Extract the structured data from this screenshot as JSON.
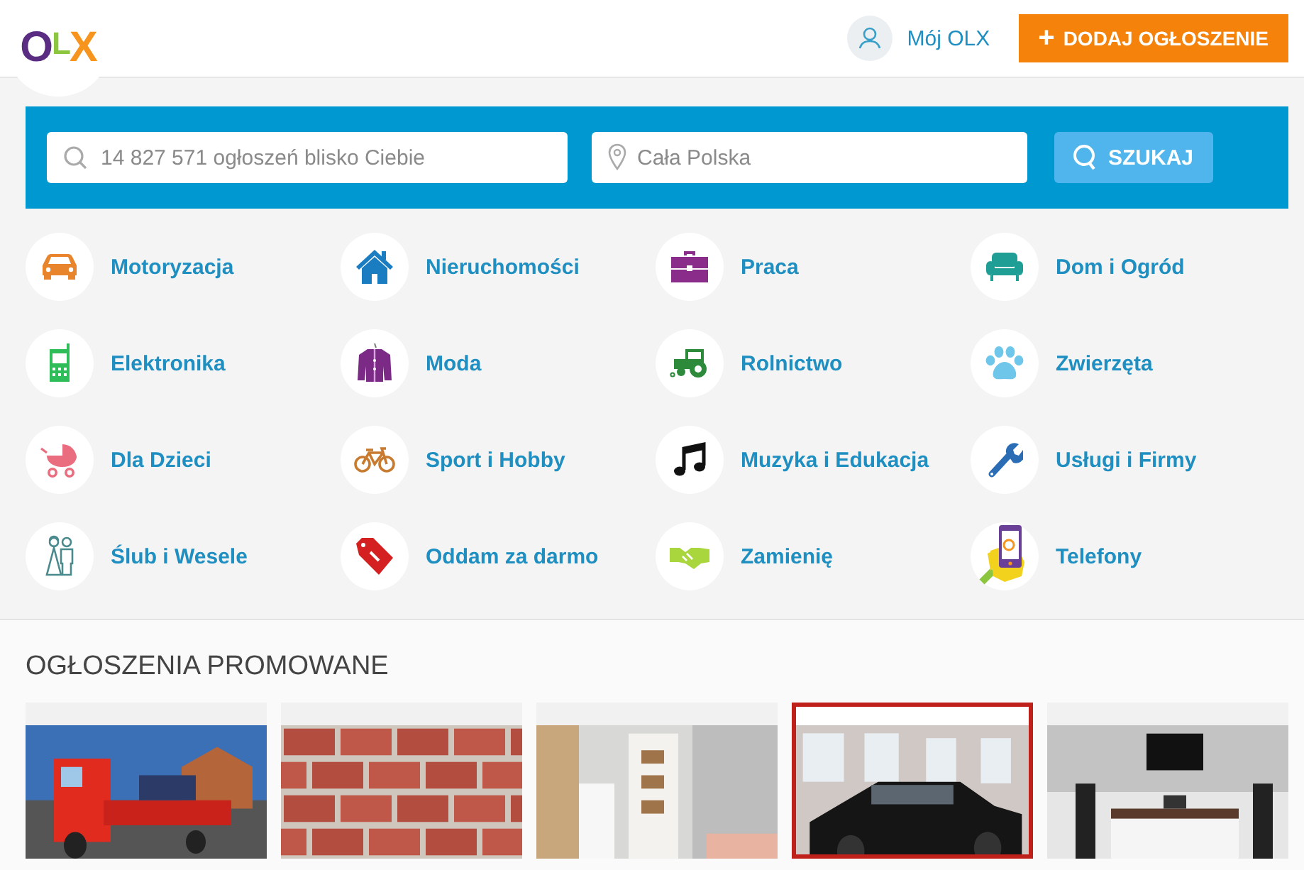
{
  "header": {
    "logo": "OLX",
    "account_link": "Mój OLX",
    "add_button": {
      "icon": "+",
      "label": "DODAJ OGŁOSZENIE"
    }
  },
  "search": {
    "query_placeholder": "14 827 571 ogłoszeń blisko Ciebie",
    "location_placeholder": "Cała Polska",
    "button": "SZUKAJ"
  },
  "categories": [
    {
      "label": "Motoryzacja",
      "kind": "car"
    },
    {
      "label": "Nieruchomości",
      "kind": "house"
    },
    {
      "label": "Praca",
      "kind": "briefcase"
    },
    {
      "label": "Dom i Ogród",
      "kind": "sofa"
    },
    {
      "label": "Elektronika",
      "kind": "phone"
    },
    {
      "label": "Moda",
      "kind": "coat"
    },
    {
      "label": "Rolnictwo",
      "kind": "tractor"
    },
    {
      "label": "Zwierzęta",
      "kind": "paw"
    },
    {
      "label": "Dla Dzieci",
      "kind": "stroller"
    },
    {
      "label": "Sport i Hobby",
      "kind": "bike"
    },
    {
      "label": "Muzyka i Edukacja",
      "kind": "note"
    },
    {
      "label": "Usługi i Firmy",
      "kind": "wrench"
    },
    {
      "label": "Ślub i Wesele",
      "kind": "couple"
    },
    {
      "label": "Oddam za darmo",
      "kind": "tag"
    },
    {
      "label": "Zamienię",
      "kind": "handshake"
    },
    {
      "label": "Telefony",
      "kind": "handphone"
    }
  ],
  "promoted": {
    "title": "OGŁOSZENIA PROMOWANE",
    "listings": [
      {
        "kind": "picture",
        "highlighted": false
      },
      {
        "kind": "picture",
        "highlighted": false
      },
      {
        "kind": "picture",
        "highlighted": false
      },
      {
        "kind": "picture",
        "highlighted": true
      },
      {
        "kind": "picture",
        "highlighted": false
      }
    ]
  }
}
